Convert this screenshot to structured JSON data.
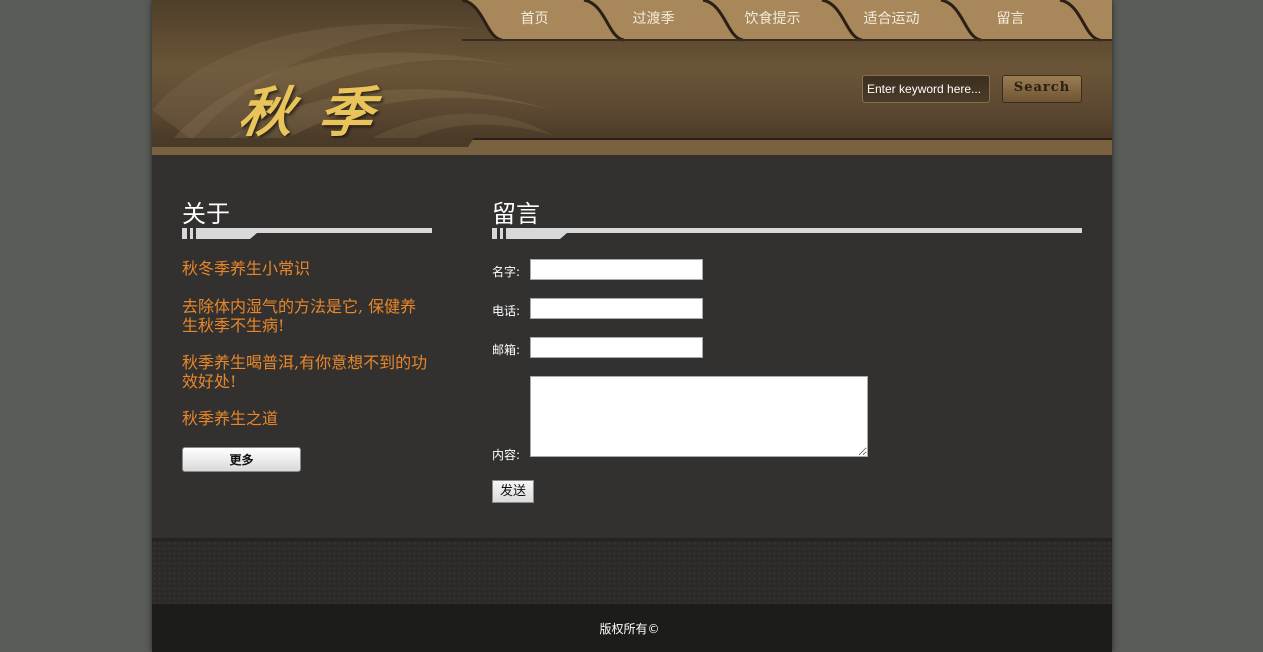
{
  "nav": {
    "items": [
      {
        "label": "首页"
      },
      {
        "label": "过渡季"
      },
      {
        "label": "饮食提示"
      },
      {
        "label": "适合运动"
      },
      {
        "label": "留言"
      }
    ]
  },
  "logo": {
    "text": "秋季"
  },
  "search": {
    "placeholder": "Enter keyword here...",
    "button_label": "Search"
  },
  "about": {
    "title": "关于",
    "links": [
      "秋冬季养生小常识",
      "去除体内湿气的方法是它, 保健养生秋季不生病!",
      "秋季养生喝普洱,有你意想不到的功效好处!",
      "秋季养生之道"
    ],
    "more_label": "更多"
  },
  "message": {
    "title": "留言",
    "name_label": "名字:",
    "phone_label": "电话:",
    "email_label": "邮箱:",
    "content_label": "内容:",
    "name_value": "",
    "phone_value": "",
    "email_value": "",
    "content_value": "",
    "send_label": "发送"
  },
  "footer": {
    "copyright": "版权所有©"
  },
  "colors": {
    "accent_link": "#e8872a",
    "header_brown": "#6b5538",
    "logo_gold": "#e8c45a",
    "page_bg": "#323130"
  }
}
